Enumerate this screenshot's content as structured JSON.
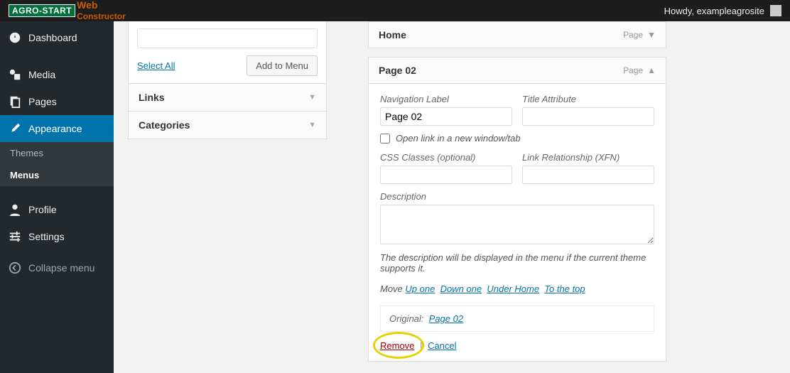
{
  "topbar": {
    "brand_primary": "AGRO-START",
    "brand_secondary_top": "Web",
    "brand_secondary_bottom": "Constructor",
    "howdy": "Howdy, exampleagrosite"
  },
  "sidebar": {
    "items": [
      {
        "id": "dashboard",
        "label": "Dashboard",
        "icon": "gauge"
      },
      {
        "id": "media",
        "label": "Media",
        "icon": "media"
      },
      {
        "id": "pages",
        "label": "Pages",
        "icon": "pages"
      },
      {
        "id": "appearance",
        "label": "Appearance",
        "icon": "brush",
        "current": true
      },
      {
        "id": "profile",
        "label": "Profile",
        "icon": "user"
      },
      {
        "id": "settings",
        "label": "Settings",
        "icon": "settings"
      }
    ],
    "subitems": [
      {
        "id": "themes",
        "label": "Themes"
      },
      {
        "id": "menus",
        "label": "Menus",
        "current": true
      }
    ],
    "collapse": "Collapse menu"
  },
  "left_panel": {
    "select_all": "Select All",
    "add_to_menu": "Add to Menu",
    "sections": [
      {
        "id": "links",
        "label": "Links"
      },
      {
        "id": "categories",
        "label": "Categories"
      }
    ]
  },
  "menu_items": [
    {
      "title": "Home",
      "type": "Page",
      "expanded": false
    },
    {
      "title": "Page 02",
      "type": "Page",
      "expanded": true
    }
  ],
  "detail": {
    "nav_label_field": "Navigation Label",
    "nav_label_value": "Page 02",
    "title_attr_field": "Title Attribute",
    "title_attr_value": "",
    "open_new_tab": "Open link in a new window/tab",
    "css_classes_field": "CSS Classes (optional)",
    "css_classes_value": "",
    "xfn_field": "Link Relationship (XFN)",
    "xfn_value": "",
    "description_field": "Description",
    "description_value": "",
    "description_hint": "The description will be displayed in the menu if the current theme supports it.",
    "move_label": "Move",
    "move_links": [
      "Up one",
      "Down one",
      "Under Home",
      "To the top"
    ],
    "original_label": "Original:",
    "original_link": "Page 02",
    "remove": "Remove",
    "cancel": "Cancel"
  }
}
